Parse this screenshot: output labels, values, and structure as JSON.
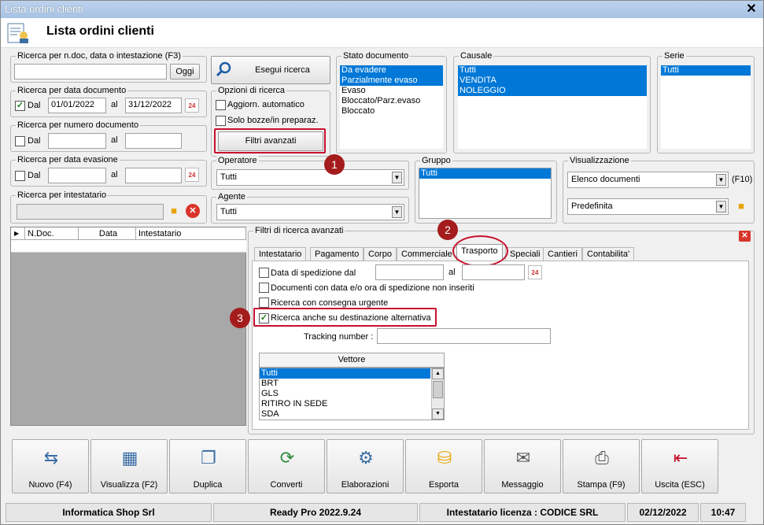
{
  "window": {
    "title": "Lista ordini clienti",
    "heading": "Lista ordini clienti"
  },
  "search": {
    "ndoc_legend": "Ricerca per n.doc, data o intestazione (F3)",
    "ndoc_value": "",
    "ogni_label": "Oggi",
    "exec_label": "Esegui ricerca",
    "datadoc_legend": "Ricerca per data documento",
    "datadoc_dal": "Dal",
    "datadoc_from": "01/01/2022",
    "datadoc_al": "al",
    "datadoc_to": "31/12/2022",
    "numdoc_legend": "Ricerca per numero documento",
    "numdoc_dal": "Dal",
    "numdoc_al": "al",
    "evas_legend": "Ricerca per data evasione",
    "evas_dal": "Dal",
    "evas_al": "al",
    "intest_legend": "Ricerca per intestatario"
  },
  "options": {
    "legend": "Opzioni di ricerca",
    "auto": "Aggiorn. automatico",
    "bozze": "Solo bozze/in preparaz.",
    "filtri": "Filtri avanzati"
  },
  "stato": {
    "legend": "Stato documento",
    "items": [
      "Da evadere",
      "Parzialmente evaso",
      "Evaso",
      "Bloccato/Parz.evaso",
      "Bloccato"
    ]
  },
  "causale": {
    "legend": "Causale",
    "items": [
      "Tutti",
      "VENDITA",
      "NOLEGGIO"
    ]
  },
  "serie": {
    "legend": "Serie",
    "items": [
      "Tutti"
    ]
  },
  "operatore": {
    "legend": "Operatore",
    "value": "Tutti"
  },
  "agente": {
    "legend": "Agente",
    "value": "Tutti"
  },
  "gruppo": {
    "legend": "Gruppo",
    "items": [
      "Tutti"
    ]
  },
  "visual": {
    "legend": "Visualizzazione",
    "value1": "Elenco documenti",
    "f10": "(F10)",
    "value2": "Predefinita"
  },
  "grid": {
    "columns": [
      "N.Doc.",
      "Data",
      "Intestatario"
    ]
  },
  "adv": {
    "legend": "Filtri di ricerca avanzati",
    "tabs": [
      "Intestatario",
      "Pagamento",
      "Corpo",
      "Commerciale",
      "Trasporto",
      "Speciali",
      "Cantieri",
      "Contabilita'"
    ],
    "sped_dal": "Data di spedizione dal",
    "sped_al": "al",
    "no_sped": "Documenti con data e/o ora di spedizione non inseriti",
    "urgente": "Ricerca con consegna urgente",
    "alternativa": "Ricerca anche su destinazione alternativa",
    "tracking": "Tracking number :",
    "vettore_header": "Vettore",
    "vettori": [
      "Tutti",
      "BRT",
      "GLS",
      "RITIRO IN SEDE",
      "SDA"
    ]
  },
  "markers": [
    "1",
    "2",
    "3"
  ],
  "toolbar": [
    {
      "label": "Nuovo (F4)",
      "icon": "new-icon"
    },
    {
      "label": "Visualizza (F2)",
      "icon": "view-icon"
    },
    {
      "label": "Duplica",
      "icon": "duplicate-icon"
    },
    {
      "label": "Converti",
      "icon": "convert-icon"
    },
    {
      "label": "Elaborazioni",
      "icon": "process-icon"
    },
    {
      "label": "Esporta",
      "icon": "export-icon"
    },
    {
      "label": "Messaggio",
      "icon": "message-icon"
    },
    {
      "label": "Stampa (F9)",
      "icon": "print-icon"
    },
    {
      "label": "Uscita (ESC)",
      "icon": "exit-icon"
    }
  ],
  "statusbar": {
    "company": "Informatica Shop Srl",
    "version": "Ready Pro 2022.9.24",
    "license": "Intestatario licenza : CODICE SRL",
    "date": "02/12/2022",
    "time": "10:47"
  }
}
